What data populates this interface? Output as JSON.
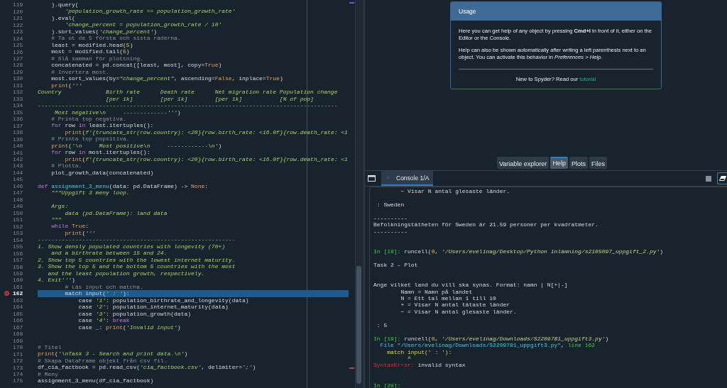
{
  "editor": {
    "lines": [
      {
        "number": "119",
        "selected": false,
        "tokens": [
          {
            "kind": "plain",
            "text": "    ).query("
          }
        ]
      },
      {
        "number": "120",
        "selected": false,
        "tokens": [
          {
            "kind": "string",
            "text": "        'population_growth_rate == population_growth_rate'"
          }
        ]
      },
      {
        "number": "121",
        "selected": false,
        "tokens": [
          {
            "kind": "plain",
            "text": "    ).eval("
          }
        ]
      },
      {
        "number": "122",
        "selected": false,
        "tokens": [
          {
            "kind": "string",
            "text": "        'change_percent = population_growth_rate / 10'"
          }
        ]
      },
      {
        "number": "123",
        "selected": false,
        "tokens": [
          {
            "kind": "plain",
            "text": "    ).sort_values("
          },
          {
            "kind": "string",
            "text": "'change_percent'"
          },
          {
            "kind": "plain",
            "text": ")"
          }
        ]
      },
      {
        "number": "124",
        "selected": false,
        "tokens": [
          {
            "kind": "comment",
            "text": "    # Ta ut de 5 första och sista raderna."
          }
        ]
      },
      {
        "number": "125",
        "selected": false,
        "tokens": [
          {
            "kind": "plain",
            "text": "    least = modified.head("
          },
          {
            "kind": "number",
            "text": "5"
          },
          {
            "kind": "plain",
            "text": ")"
          }
        ]
      },
      {
        "number": "126",
        "selected": false,
        "tokens": [
          {
            "kind": "plain",
            "text": "    most = modified.tail("
          },
          {
            "kind": "number",
            "text": "5"
          },
          {
            "kind": "plain",
            "text": ")"
          }
        ]
      },
      {
        "number": "127",
        "selected": false,
        "tokens": [
          {
            "kind": "comment",
            "text": "    # Slå samman för plottning."
          }
        ]
      },
      {
        "number": "128",
        "selected": false,
        "tokens": [
          {
            "kind": "plain",
            "text": "    concatenated = pd.concat([least, most], copy="
          },
          {
            "kind": "builtin",
            "text": "True"
          },
          {
            "kind": "plain",
            "text": ")"
          }
        ]
      },
      {
        "number": "129",
        "selected": false,
        "tokens": [
          {
            "kind": "comment",
            "text": "    # Invertera most."
          }
        ]
      },
      {
        "number": "130",
        "selected": false,
        "tokens": [
          {
            "kind": "plain",
            "text": "    most.sort_values(by="
          },
          {
            "kind": "string",
            "text": "\"change_percent\""
          },
          {
            "kind": "plain",
            "text": ", ascending="
          },
          {
            "kind": "builtin",
            "text": "False"
          },
          {
            "kind": "plain",
            "text": ", inplace="
          },
          {
            "kind": "builtin",
            "text": "True"
          },
          {
            "kind": "plain",
            "text": ")"
          }
        ]
      },
      {
        "number": "131",
        "selected": false,
        "tokens": [
          {
            "kind": "builtin",
            "text": "    print"
          },
          {
            "kind": "plain",
            "text": "("
          },
          {
            "kind": "string",
            "text": "'''"
          }
        ]
      },
      {
        "number": "132",
        "selected": false,
        "tokens": [
          {
            "kind": "string",
            "text": "Country             Birth rate      Death rate      Net migration rate Population change"
          }
        ]
      },
      {
        "number": "133",
        "selected": false,
        "tokens": [
          {
            "kind": "string",
            "text": "                    [per 1k]        [per 1k]        [per 1k]           [% of pop]"
          }
        ]
      },
      {
        "number": "134",
        "selected": false,
        "tokens": [
          {
            "kind": "string",
            "text": "----------------------------------------------------------------------------------------"
          }
        ]
      },
      {
        "number": "135",
        "selected": false,
        "tokens": [
          {
            "kind": "string",
            "text": "     Most negative\\n     -------------'''"
          },
          {
            "kind": "plain",
            "text": ")"
          }
        ]
      },
      {
        "number": "136",
        "selected": false,
        "tokens": [
          {
            "kind": "comment",
            "text": "    # Printa top negativa."
          }
        ]
      },
      {
        "number": "137",
        "selected": false,
        "tokens": [
          {
            "kind": "keyword",
            "text": "    for"
          },
          {
            "kind": "plain",
            "text": " row "
          },
          {
            "kind": "keyword",
            "text": "in"
          },
          {
            "kind": "plain",
            "text": " least.itertuples():"
          }
        ]
      },
      {
        "number": "138",
        "selected": false,
        "tokens": [
          {
            "kind": "builtin",
            "text": "        print"
          },
          {
            "kind": "plain",
            "text": "("
          },
          {
            "kind": "string",
            "text": "f'{truncate_str(row.country): <20}{row.birth_rate: <16.0f}{row.death_rate: <1"
          }
        ]
      },
      {
        "number": "139",
        "selected": false,
        "tokens": [
          {
            "kind": "comment",
            "text": "    # Printa top popsitiva."
          }
        ]
      },
      {
        "number": "140",
        "selected": false,
        "tokens": [
          {
            "kind": "builtin",
            "text": "    print"
          },
          {
            "kind": "plain",
            "text": "("
          },
          {
            "kind": "string",
            "text": "'\\n     Most positive\\n     ------------\\n'"
          },
          {
            "kind": "plain",
            "text": ")"
          }
        ]
      },
      {
        "number": "141",
        "selected": false,
        "tokens": [
          {
            "kind": "keyword",
            "text": "    for"
          },
          {
            "kind": "plain",
            "text": " row "
          },
          {
            "kind": "keyword",
            "text": "in"
          },
          {
            "kind": "plain",
            "text": " most.itertuples():"
          }
        ]
      },
      {
        "number": "142",
        "selected": false,
        "tokens": [
          {
            "kind": "builtin",
            "text": "        print"
          },
          {
            "kind": "plain",
            "text": "("
          },
          {
            "kind": "string",
            "text": "f'{truncate_str(row.country): <20}{row.birth_rate: <16.0f}{row.death_rate: <1"
          }
        ]
      },
      {
        "number": "143",
        "selected": false,
        "tokens": [
          {
            "kind": "comment",
            "text": "    # Plotta."
          }
        ]
      },
      {
        "number": "144",
        "selected": false,
        "tokens": [
          {
            "kind": "plain",
            "text": "    plot_growth_data(concatenated)"
          }
        ]
      },
      {
        "number": "145",
        "selected": false
      },
      {
        "number": "146",
        "selected": false,
        "tokens": [
          {
            "kind": "keyword",
            "text": "def"
          },
          {
            "kind": "defname",
            "text": " assignment_3_menu"
          },
          {
            "kind": "plain",
            "text": "(data: pd.DataFrame) -> "
          },
          {
            "kind": "builtin",
            "text": "None"
          },
          {
            "kind": "plain",
            "text": ":"
          }
        ]
      },
      {
        "number": "147",
        "selected": false,
        "tokens": [
          {
            "kind": "string",
            "text": "    \"\"\"Uppgift 3 meny loop."
          }
        ]
      },
      {
        "number": "148",
        "selected": false
      },
      {
        "number": "149",
        "selected": false,
        "tokens": [
          {
            "kind": "string",
            "text": "    Args:"
          }
        ]
      },
      {
        "number": "150",
        "selected": false,
        "tokens": [
          {
            "kind": "string",
            "text": "        data (pd.DataFrame): land data"
          }
        ]
      },
      {
        "number": "151",
        "selected": false,
        "tokens": [
          {
            "kind": "string",
            "text": "    \"\"\""
          }
        ]
      },
      {
        "number": "152",
        "selected": false,
        "tokens": [
          {
            "kind": "keyword",
            "text": "    while"
          },
          {
            "kind": "builtin",
            "text": " True"
          },
          {
            "kind": "plain",
            "text": ":"
          }
        ]
      },
      {
        "number": "153",
        "selected": false,
        "tokens": [
          {
            "kind": "builtin",
            "text": "        print"
          },
          {
            "kind": "plain",
            "text": "("
          },
          {
            "kind": "string",
            "text": "'''"
          }
        ]
      },
      {
        "number": "154",
        "selected": false,
        "tokens": [
          {
            "kind": "string",
            "text": "----------------------------------------------------------"
          }
        ]
      },
      {
        "number": "155",
        "selected": false,
        "tokens": [
          {
            "kind": "string",
            "text": "1. Show densly populated countries with longevity (70+)"
          }
        ]
      },
      {
        "number": "156",
        "selected": false,
        "tokens": [
          {
            "kind": "string",
            "text": "    and a birthrate between 15 and 24."
          }
        ]
      },
      {
        "number": "157",
        "selected": false,
        "tokens": [
          {
            "kind": "string",
            "text": "2. Show top 5 countries with the lowest internet maturity."
          }
        ]
      },
      {
        "number": "158",
        "selected": false,
        "tokens": [
          {
            "kind": "string",
            "text": "3. Show the top 5 and the bottom 5 countries with the most"
          }
        ]
      },
      {
        "number": "159",
        "selected": false,
        "tokens": [
          {
            "kind": "string",
            "text": "   and the least population growth, respectively."
          }
        ]
      },
      {
        "number": "160",
        "selected": false,
        "tokens": [
          {
            "kind": "string",
            "text": "4. Exit'''"
          },
          {
            "kind": "plain",
            "text": ")"
          }
        ]
      },
      {
        "number": "161",
        "selected": false,
        "tokens": [
          {
            "kind": "comment",
            "text": "        # Läs input och matcha."
          }
        ]
      },
      {
        "number": "162",
        "selected": true,
        "error": true,
        "tokens": [
          {
            "kind": "plain",
            "text": "        match input("
          },
          {
            "kind": "string",
            "text": "' : '"
          },
          {
            "kind": "plain",
            "text": "):"
          }
        ]
      },
      {
        "number": "163",
        "selected": false,
        "tokens": [
          {
            "kind": "plain",
            "text": "            case "
          },
          {
            "kind": "string",
            "text": "'1'"
          },
          {
            "kind": "plain",
            "text": ": population_birthrate_and_longevity(data)"
          }
        ]
      },
      {
        "number": "164",
        "selected": false,
        "tokens": [
          {
            "kind": "plain",
            "text": "            case "
          },
          {
            "kind": "string",
            "text": "'2'"
          },
          {
            "kind": "plain",
            "text": ": population_internet_maturity(data)"
          }
        ]
      },
      {
        "number": "165",
        "selected": false,
        "tokens": [
          {
            "kind": "plain",
            "text": "            case "
          },
          {
            "kind": "string",
            "text": "'3'"
          },
          {
            "kind": "plain",
            "text": ": population_growth(data)"
          }
        ]
      },
      {
        "number": "166",
        "selected": false,
        "tokens": [
          {
            "kind": "plain",
            "text": "            case "
          },
          {
            "kind": "string",
            "text": "'4'"
          },
          {
            "kind": "plain",
            "text": ": "
          },
          {
            "kind": "keyword",
            "text": "break"
          }
        ]
      },
      {
        "number": "167",
        "selected": false,
        "tokens": [
          {
            "kind": "plain",
            "text": "            case _: "
          },
          {
            "kind": "builtin",
            "text": "print"
          },
          {
            "kind": "plain",
            "text": "("
          },
          {
            "kind": "string",
            "text": "'Invalid input'"
          },
          {
            "kind": "plain",
            "text": ")"
          }
        ]
      },
      {
        "number": "168",
        "selected": false
      },
      {
        "number": "169",
        "selected": false
      },
      {
        "number": "170",
        "selected": false,
        "tokens": [
          {
            "kind": "comment",
            "text": "# Titel"
          }
        ]
      },
      {
        "number": "171",
        "selected": false,
        "tokens": [
          {
            "kind": "builtin",
            "text": "print"
          },
          {
            "kind": "plain",
            "text": "("
          },
          {
            "kind": "string",
            "text": "'\\nTask 3 - Search and print data.\\n'"
          },
          {
            "kind": "plain",
            "text": ")"
          }
        ]
      },
      {
        "number": "172",
        "selected": false,
        "tokens": [
          {
            "kind": "comment",
            "text": "# Skapa DataFrame objekt från csv fil."
          }
        ]
      },
      {
        "number": "173",
        "selected": false,
        "tokens": [
          {
            "kind": "plain",
            "text": "df_cia_factbook = pd.read_csv("
          },
          {
            "kind": "string",
            "text": "'cia_factbook.csv'"
          },
          {
            "kind": "plain",
            "text": ", delimiter="
          },
          {
            "kind": "string",
            "text": "';'"
          },
          {
            "kind": "plain",
            "text": ")"
          }
        ]
      },
      {
        "number": "174",
        "selected": false,
        "tokens": [
          {
            "kind": "comment",
            "text": "# Meny"
          }
        ]
      },
      {
        "number": "175",
        "selected": false,
        "tokens": [
          {
            "kind": "plain",
            "text": "assignment_3_menu(df_cia_factbook)"
          }
        ]
      }
    ]
  },
  "help": {
    "title": "Usage",
    "paragraphs": [
      "Here you can get help of any object by pressing **Cmd+I** in front of it, either on the Editor or the Console.",
      "Help can also be shown automatically after writing a left parenthesis next to an object. You can activate this behavior in *Preferences > Help*."
    ],
    "footer": "New to Spyder? Read our ",
    "link": "tutorial"
  },
  "pane_tabs": [
    {
      "label": "Variable explorer",
      "selected": false
    },
    {
      "label": "Help",
      "selected": true
    },
    {
      "label": "Plots",
      "selected": false
    },
    {
      "label": "Files",
      "selected": false
    }
  ],
  "console": {
    "tabs": [
      {
        "label": "Console 1/A",
        "selected": true
      }
    ],
    "lines": [
      {
        "kind": "text",
        "tokens": [
          {
            "kind": "plain",
            "text": "        − Visar N antal glesaste länder."
          }
        ]
      },
      {
        "kind": "blank"
      },
      {
        "kind": "text",
        "tokens": [
          {
            "kind": "plain",
            "text": " : Sweden"
          }
        ]
      },
      {
        "kind": "blank"
      },
      {
        "kind": "text",
        "tokens": [
          {
            "kind": "plain",
            "text": "----------"
          }
        ]
      },
      {
        "kind": "text",
        "tokens": [
          {
            "kind": "plain",
            "text": "Befolkningstätheten för Sweden är 21.59 personer per kvadratmeter."
          }
        ]
      },
      {
        "kind": "text",
        "tokens": [
          {
            "kind": "plain",
            "text": "----------"
          }
        ]
      },
      {
        "kind": "blank"
      },
      {
        "kind": "blank"
      },
      {
        "kind": "text",
        "tokens": [
          {
            "kind": "prompt",
            "text": "In [18]:"
          },
          {
            "kind": "plain",
            "text": " runcell("
          },
          {
            "kind": "number",
            "text": "0"
          },
          {
            "kind": "plain",
            "text": ", "
          },
          {
            "kind": "string",
            "text": "'/Users/evelinag/Desktop/Python inlämning/s2105097_uppgift_2.py'"
          },
          {
            "kind": "plain",
            "text": ")"
          }
        ]
      },
      {
        "kind": "blank"
      },
      {
        "kind": "text",
        "tokens": [
          {
            "kind": "plain",
            "text": "Task 2 – Plot"
          }
        ]
      },
      {
        "kind": "blank"
      },
      {
        "kind": "blank"
      },
      {
        "kind": "text",
        "tokens": [
          {
            "kind": "plain",
            "text": "Ange vilket land du vill ska synas. Format: namn | N[+|-]"
          }
        ]
      },
      {
        "kind": "text",
        "tokens": [
          {
            "kind": "plain",
            "text": "        Namn = Namn på landet"
          }
        ]
      },
      {
        "kind": "text",
        "tokens": [
          {
            "kind": "plain",
            "text": "        N = Ett tal mellan 1 till 10"
          }
        ]
      },
      {
        "kind": "text",
        "tokens": [
          {
            "kind": "plain",
            "text": "        + = Visar N antal tätaste länder"
          }
        ]
      },
      {
        "kind": "text",
        "tokens": [
          {
            "kind": "plain",
            "text": "        − = Visar N antal glesaste länder."
          }
        ]
      },
      {
        "kind": "blank"
      },
      {
        "kind": "text",
        "tokens": [
          {
            "kind": "plain",
            "text": " : 5"
          }
        ]
      },
      {
        "kind": "blank"
      },
      {
        "kind": "text",
        "tokens": [
          {
            "kind": "prompt",
            "text": "In [19]:"
          },
          {
            "kind": "plain",
            "text": " runcell("
          },
          {
            "kind": "number",
            "text": "0"
          },
          {
            "kind": "plain",
            "text": ", "
          },
          {
            "kind": "string",
            "text": "'/Users/evelinag/Downloads/S2209781_uppgift3.py'"
          },
          {
            "kind": "plain",
            "text": ")"
          }
        ]
      },
      {
        "kind": "text",
        "tokens": [
          {
            "kind": "trace",
            "text": "  File \"/Users/evelinag/Downloads/S2209781_uppgift3.py\""
          },
          {
            "kind": "plain",
            "text": ", "
          },
          {
            "kind": "prompt",
            "text": "line 162"
          }
        ]
      },
      {
        "kind": "text",
        "tokens": [
          {
            "kind": "source",
            "text": "    match input(' : '):"
          }
        ]
      },
      {
        "kind": "text",
        "tokens": [
          {
            "kind": "plain",
            "text": "          ^"
          }
        ]
      },
      {
        "kind": "text",
        "tokens": [
          {
            "kind": "error",
            "text": "SyntaxError:"
          },
          {
            "kind": "plain",
            "text": " invalid syntax"
          }
        ]
      },
      {
        "kind": "blank"
      },
      {
        "kind": "blank"
      },
      {
        "kind": "text",
        "tokens": [
          {
            "kind": "prompt",
            "text": "In [20]:"
          }
        ]
      }
    ]
  }
}
